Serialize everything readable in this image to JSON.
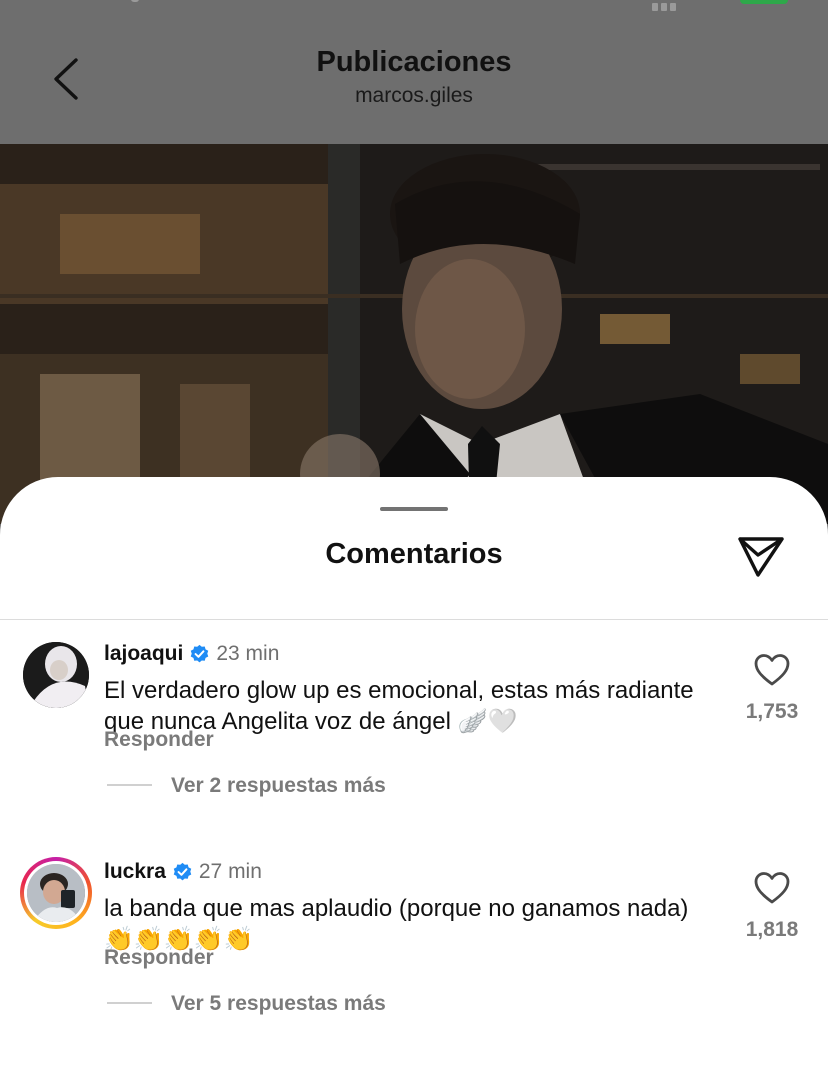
{
  "header": {
    "title": "Publicaciones",
    "subtitle": "marcos.giles"
  },
  "sheet": {
    "title": "Comentarios"
  },
  "comments": [
    {
      "username": "lajoaqui",
      "verified": true,
      "time": "23 min",
      "text": "El verdadero glow up es emocional, estas más radiante que nunca Angelita voz de ángel",
      "emojis": "🪽🤍",
      "reply_label": "Responder",
      "more_replies": "Ver 2 respuestas más",
      "likes": "1,753"
    },
    {
      "username": "luckra",
      "verified": true,
      "time": "27 min",
      "text": "la banda que mas aplaudio (porque no ganamos nada)",
      "emojis": "👏👏👏👏👏",
      "reply_label": "Responder",
      "more_replies": "Ver 5 respuestas más",
      "likes": "1,818"
    }
  ],
  "icons": {
    "back": "chevron-left-icon",
    "share": "send-icon",
    "verified": "verified-badge-icon",
    "like": "heart-outline-icon"
  },
  "colors": {
    "verified": "#1f8cf5",
    "secondary_text": "#7a7a7a",
    "story_ring": "#e8274e"
  }
}
